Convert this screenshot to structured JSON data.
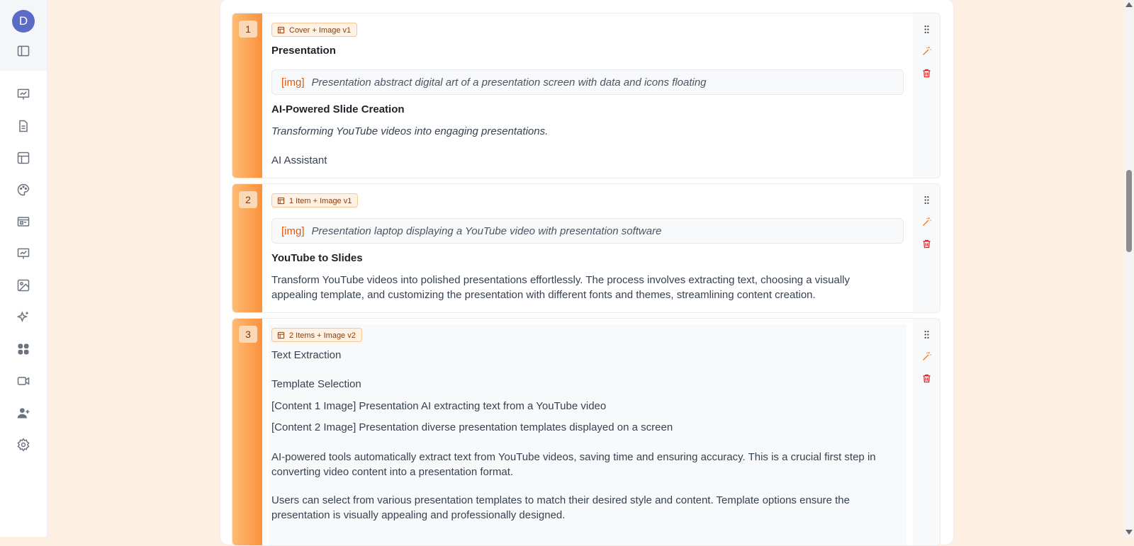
{
  "user": {
    "avatar_initial": "D"
  },
  "sidebar": {
    "icons": [
      "sidebar-toggle-icon",
      "presentation-chart-icon",
      "document-icon",
      "layout-icon",
      "palette-icon",
      "slideshow-icon",
      "analytics-icon",
      "image-icon",
      "sparkles-icon",
      "apps-icon",
      "video-icon",
      "add-user-icon",
      "settings-icon"
    ]
  },
  "slides": [
    {
      "number": "1",
      "layout_label": "Cover + Image v1",
      "title": "Presentation",
      "image_tag": "[img]",
      "image_desc": "Presentation abstract digital art of a presentation screen with data and icons floating",
      "heading": "AI-Powered Slide Creation",
      "subtitle": "Transforming YouTube videos into engaging presentations.",
      "author": "AI Assistant"
    },
    {
      "number": "2",
      "layout_label": "1 Item + Image v1",
      "image_tag": "[img]",
      "image_desc": "Presentation laptop displaying a YouTube video with presentation software",
      "heading": "YouTube to Slides",
      "body": "Transform YouTube videos into polished presentations effortlessly. The process involves extracting text, choosing a visually appealing template, and customizing the presentation with different fonts and themes, streamlining content creation."
    },
    {
      "number": "3",
      "layout_label": "2 Items + Image v2",
      "item1_title": "Text Extraction",
      "item2_title": "Template Selection",
      "content1_image": "[Content 1 Image] Presentation AI extracting text from a YouTube video",
      "content2_image": "[Content 2 Image] Presentation diverse presentation templates displayed on a screen",
      "item1_body": "AI-powered tools automatically extract text from YouTube videos, saving time and ensuring accuracy. This is a crucial first step in converting video content into a presentation format.",
      "item2_body": "Users can select from various presentation templates to match their desired style and content. Template options ensure the presentation is visually appealing and professionally designed."
    }
  ],
  "colors": {
    "accent": "#fb923c",
    "background": "#fdf0e2",
    "avatar": "#5b6cc6",
    "danger": "#dc2626",
    "magic": "#f97316"
  }
}
